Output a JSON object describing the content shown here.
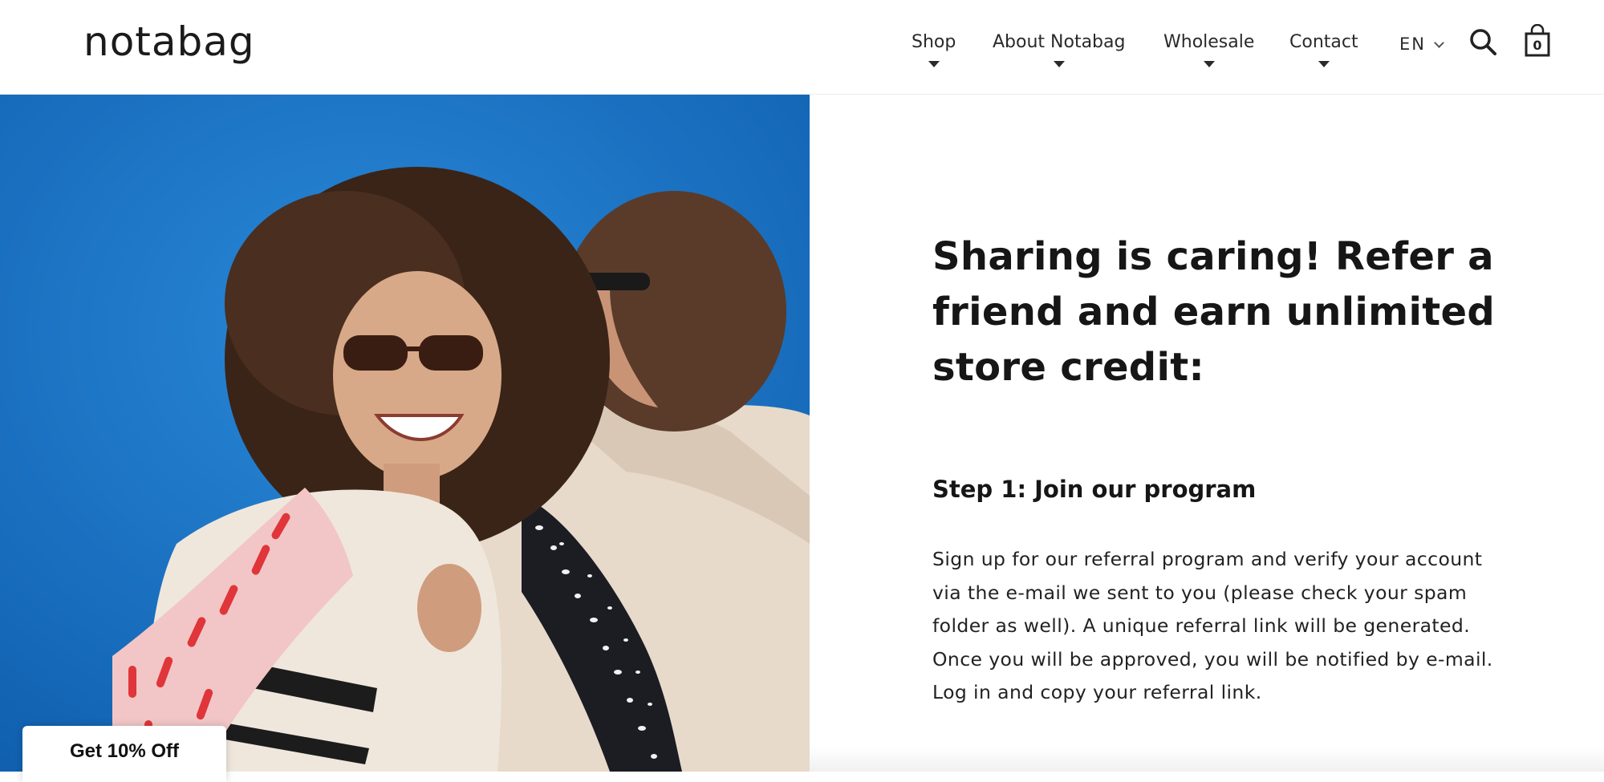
{
  "header": {
    "logo": "notabag",
    "nav": [
      {
        "label": "Shop"
      },
      {
        "label": "About Notabag"
      },
      {
        "label": "Wholesale"
      },
      {
        "label": "Contact"
      }
    ],
    "language": "EN",
    "cart_count": "0",
    "icons": {
      "search": "search-icon",
      "cart": "shopping-bag-icon",
      "language": "chevron-down-icon",
      "nav_caret": "caret-down-icon"
    }
  },
  "hero": {
    "description_colors": {
      "sky": "#1e74c6",
      "pink_bag": "#f2c6c6",
      "red_dash": "#e0353a",
      "jacket": "#efe7dc",
      "hoodie": "#e6d8c8",
      "backpack": "#1b1d22"
    }
  },
  "referral": {
    "headline": "Sharing is caring! Refer a friend and earn unlimited store credit:",
    "headline_lines": [
      "Sharing is caring! Refer a",
      "friend and earn unlimited",
      "store credit:"
    ],
    "step_title": "Step 1: Join our program",
    "step_lines": [
      "Sign up for our referral program and verify your account",
      "via the e-mail we sent to you (please check your spam",
      "folder as well). A unique referral link will be generated.",
      "Once you will be approved, you will be notified by e-mail.",
      "Log in and copy your referral link."
    ]
  },
  "popup": {
    "discount_label": "Get 10% Off"
  }
}
